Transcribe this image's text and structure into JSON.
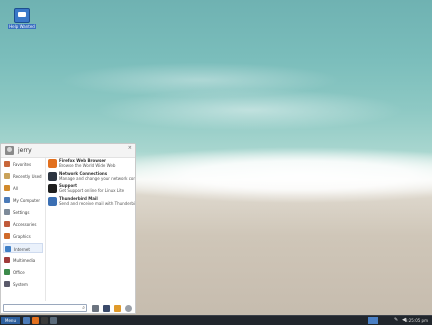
{
  "desktop": {
    "icon_label": "Help Wanted"
  },
  "menu": {
    "username": "jerry",
    "close_label": "×",
    "categories": [
      {
        "label": "Favorites",
        "color": "#c8673a"
      },
      {
        "label": "Recently Used",
        "color": "#c9a25a"
      },
      {
        "label": "All",
        "color": "#d18a2c"
      },
      {
        "label": "My Computer",
        "color": "#4c7bb8"
      },
      {
        "label": "Settings",
        "color": "#7d8a99"
      },
      {
        "label": "Accessories",
        "color": "#c05a3a"
      },
      {
        "label": "Graphics",
        "color": "#d06a2a"
      },
      {
        "label": "Internet",
        "color": "#3f7fc6"
      },
      {
        "label": "Multimedia",
        "color": "#a03a3a"
      },
      {
        "label": "Office",
        "color": "#3c8a4a"
      },
      {
        "label": "System",
        "color": "#5a5a6a"
      }
    ],
    "selected_category": "Internet",
    "apps": [
      {
        "name": "Firefox Web Browser",
        "desc": "Browse the World Wide Web",
        "color": "#e2701e"
      },
      {
        "name": "Network Connections",
        "desc": "Manage and change your network conn...",
        "color": "#2c3440"
      },
      {
        "name": "Support",
        "desc": "Get Support online for Linux Lite",
        "color": "#1e1e1e"
      },
      {
        "name": "Thunderbird Mail",
        "desc": "Send and receive mail with Thunderbird",
        "color": "#3b6fb3"
      }
    ],
    "search": {
      "value": "",
      "icon": "search-icon"
    },
    "bottom_icons": [
      "screenshot-icon",
      "display-icon",
      "warning-icon",
      "settings-icon"
    ]
  },
  "taskbar": {
    "menu_label": "Menu",
    "clock": "3:25:05 pm"
  }
}
